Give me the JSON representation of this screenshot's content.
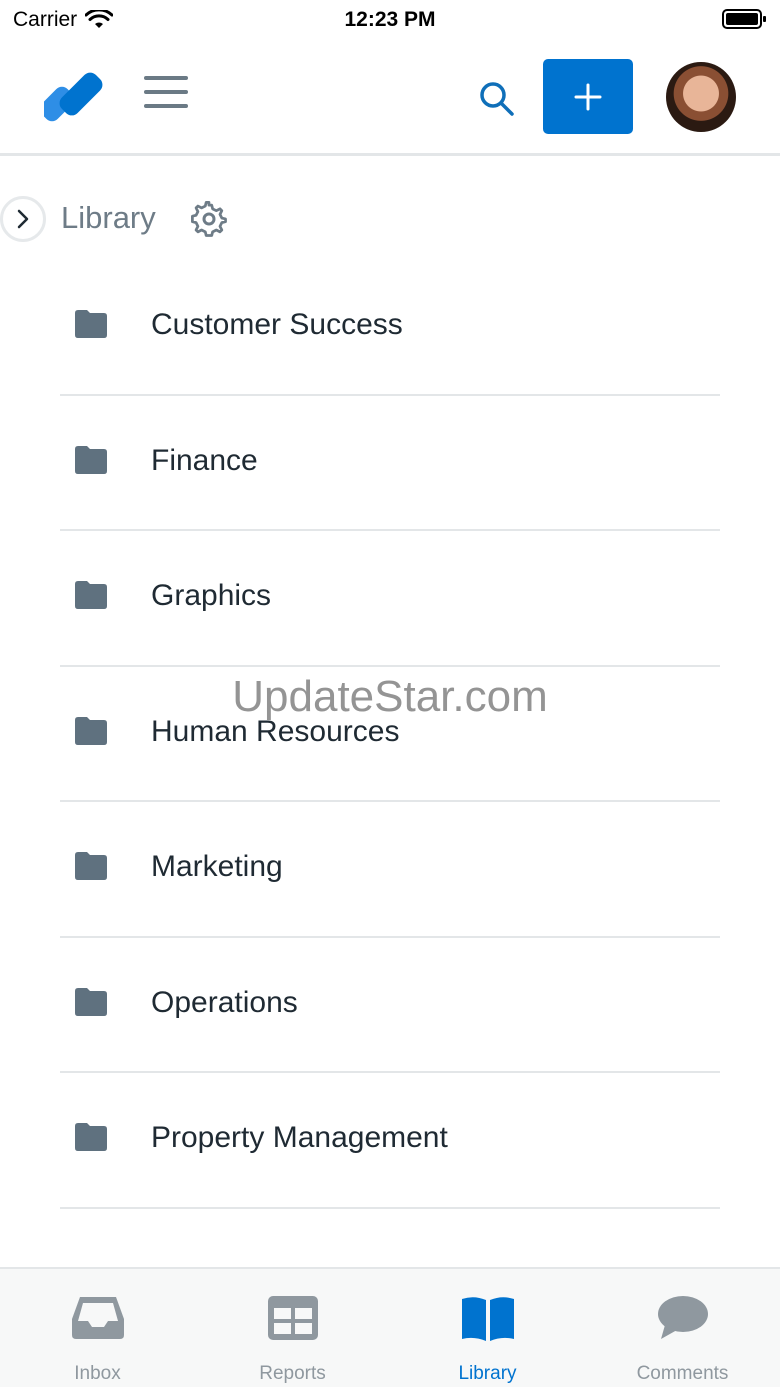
{
  "status_bar": {
    "carrier": "Carrier",
    "time": "12:23 PM"
  },
  "header": {
    "logo_icon": "app-logo-icon",
    "menu_icon": "hamburger-menu-icon",
    "search_icon": "search-icon",
    "add_icon": "plus-icon",
    "avatar_icon": "user-avatar"
  },
  "breadcrumb": {
    "title": "Library",
    "expand_icon": "chevron-right-icon",
    "settings_icon": "gear-icon"
  },
  "folders": [
    {
      "label": "Customer Success",
      "icon": "folder-icon"
    },
    {
      "label": "Finance",
      "icon": "folder-icon"
    },
    {
      "label": "Graphics",
      "icon": "folder-icon"
    },
    {
      "label": "Human Resources",
      "icon": "folder-icon"
    },
    {
      "label": "Marketing",
      "icon": "folder-icon"
    },
    {
      "label": "Operations",
      "icon": "folder-icon"
    },
    {
      "label": "Property Management",
      "icon": "folder-icon"
    }
  ],
  "watermark": "UpdateStar.com",
  "tabs": [
    {
      "label": "Inbox",
      "icon": "inbox-tray-icon",
      "active": false
    },
    {
      "label": "Reports",
      "icon": "grid-table-icon",
      "active": false
    },
    {
      "label": "Library",
      "icon": "open-book-icon",
      "active": true
    },
    {
      "label": "Comments",
      "icon": "speech-bubble-icon",
      "active": false
    }
  ],
  "colors": {
    "accent": "#0073cf",
    "icon_gray": "#5f717f",
    "text": "#1f2a33",
    "muted": "#6e7c87",
    "divider": "#e3e6e8"
  }
}
